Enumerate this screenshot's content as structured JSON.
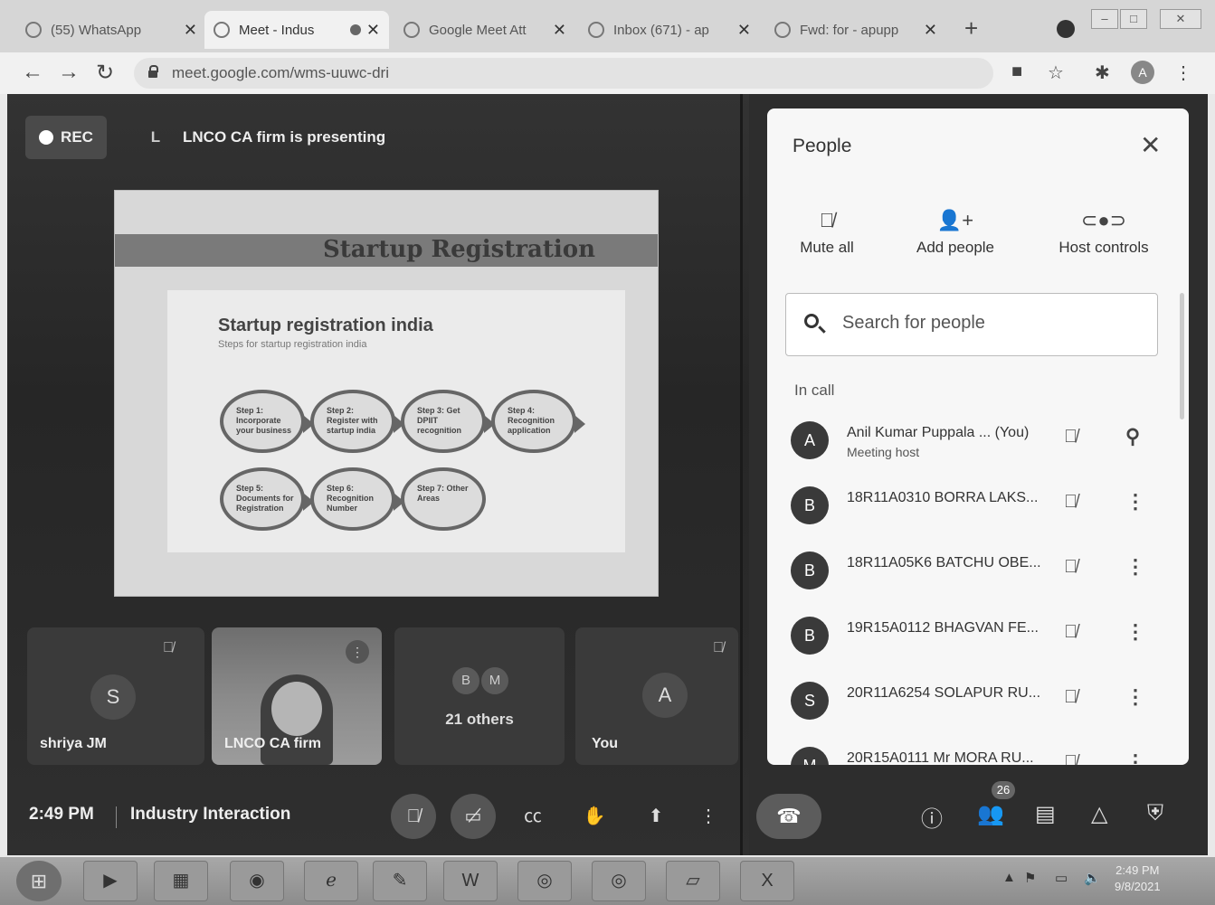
{
  "browser": {
    "tabs": [
      {
        "label": "(55) WhatsApp",
        "active": false
      },
      {
        "label": "Meet - Indus",
        "active": true
      },
      {
        "label": "Google Meet Att",
        "active": false
      },
      {
        "label": "Inbox (671) - ap",
        "active": false
      },
      {
        "label": "Fwd: for - apupp",
        "active": false
      }
    ],
    "new_tab": "+",
    "url": "meet.google.com/wms-uuwc-dri",
    "profile_initial": "A"
  },
  "meet": {
    "rec_label": "REC",
    "presenter_initial": "L",
    "presenting_text": "LNCO CA firm is presenting",
    "slide": {
      "title": "Startup Registration",
      "heading": "Startup registration india",
      "subheading": "Steps for startup registration india",
      "steps": [
        "Step 1: Incorporate your business",
        "Step 2: Register with startup india",
        "Step 3: Get DPIIT recognition",
        "Step 4: Recognition application",
        "Step 5: Documents for Registration",
        "Step 6: Recognition Number",
        "Step 7: Other Areas"
      ]
    },
    "tiles": {
      "shriya": {
        "initial": "S",
        "name": "shriya JM"
      },
      "lnco": {
        "name": "LNCO CA firm"
      },
      "others": {
        "initials": [
          "B",
          "M"
        ],
        "label": "21 others"
      },
      "you": {
        "initial": "A",
        "name": "You"
      }
    },
    "bottom": {
      "time": "2:49 PM",
      "meeting_name": "Industry Interaction",
      "people_count": "26"
    }
  },
  "people_panel": {
    "title": "People",
    "actions": [
      {
        "label": "Mute all",
        "icon": "mic-off-icon"
      },
      {
        "label": "Add people",
        "icon": "add-person-icon"
      },
      {
        "label": "Host controls",
        "icon": "toggle-icon"
      }
    ],
    "search_placeholder": "Search for people",
    "section_label": "In call",
    "participants": [
      {
        "initial": "A",
        "name": "Anil Kumar Puppala ... (You)",
        "role": "Meeting host"
      },
      {
        "initial": "B",
        "name": "18R11A0310 BORRA LAKS..."
      },
      {
        "initial": "B",
        "name": "18R11A05K6 BATCHU OBE..."
      },
      {
        "initial": "B",
        "name": "19R15A0112 BHAGVAN FE..."
      },
      {
        "initial": "S",
        "name": "20R11A6254 SOLAPUR RU..."
      },
      {
        "initial": "M",
        "name": "20R15A0111 Mr MORA RU..."
      }
    ]
  },
  "taskbar": {
    "time": "2:49 PM",
    "date": "9/8/2021"
  }
}
